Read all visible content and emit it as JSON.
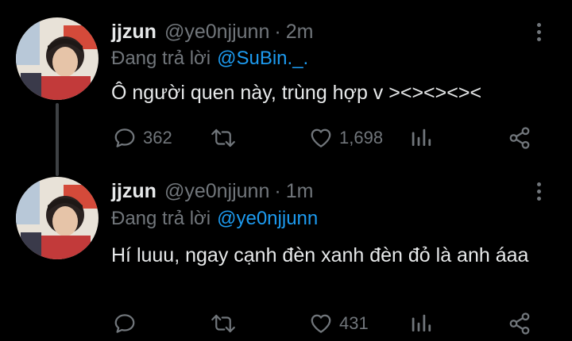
{
  "reply_prefix": "Đang trả lời",
  "colors": {
    "background": "#000000",
    "text": "#e7e9ea",
    "muted": "#71767b",
    "accent": "#1d9bf0"
  },
  "icons": [
    "reply-icon",
    "retweet-icon",
    "like-icon",
    "stats-icon",
    "share-icon",
    "more-icon"
  ],
  "tweets": [
    {
      "name": "jjzun",
      "handle": "@ye0njjunn",
      "time": "2m",
      "replying_to": "@SuBin._.",
      "text": "Ô người quen này, trùng hợp v ><><><><",
      "replies": "362",
      "retweets": "",
      "likes": "1,698"
    },
    {
      "name": "jjzun",
      "handle": "@ye0njjunn",
      "time": "1m",
      "replying_to": "@ye0njjunn",
      "text": "Hí luuu, ngay cạnh đèn xanh đèn đỏ là anh áaa",
      "replies": "",
      "retweets": "",
      "likes": "431"
    }
  ]
}
